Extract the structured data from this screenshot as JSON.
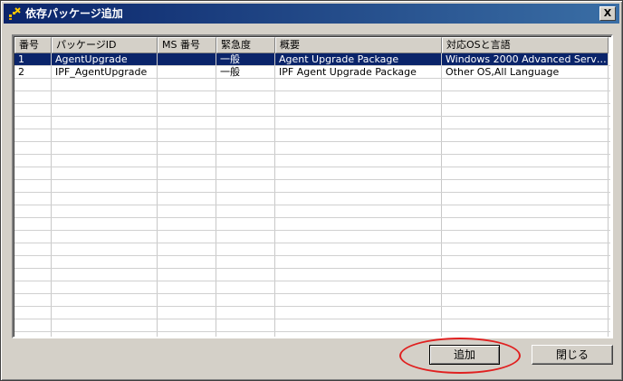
{
  "window": {
    "title": "依存パッケージ追加",
    "close_glyph": "X"
  },
  "table": {
    "columns": [
      "番号",
      "パッケージID",
      "MS 番号",
      "緊急度",
      "概要",
      "対応OSと言語"
    ],
    "rows": [
      [
        "1",
        "AgentUpgrade",
        "",
        "一般",
        "Agent Upgrade Package",
        "Windows 2000 Advanced Serve..."
      ],
      [
        "2",
        "IPF_AgentUpgrade",
        "",
        "一般",
        "IPF Agent Upgrade Package",
        "Other OS,All Language"
      ]
    ],
    "selected_row": 0
  },
  "buttons": {
    "add_label": "追加",
    "close_label": "閉じる"
  },
  "colors": {
    "titlebar": "#0a246a",
    "selection": "#0a246a",
    "highlight_ring": "#e02020"
  }
}
